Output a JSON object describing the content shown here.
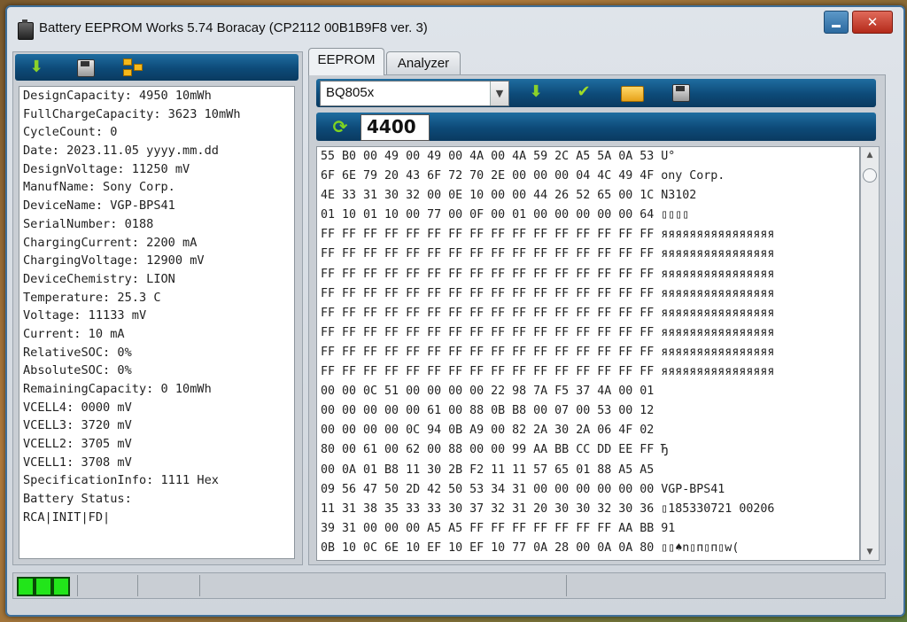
{
  "window": {
    "title": "Battery EEPROM Works  5.74 Boracay (CP2112 00B1B9F8 ver. 3)",
    "close_glyph": "✕"
  },
  "left_panel": {
    "info_lines": [
      "DesignCapacity: 4950 10mWh",
      "FullChargeCapacity: 3623 10mWh",
      "CycleCount: 0",
      "Date: 2023.11.05 yyyy.mm.dd",
      "DesignVoltage: 11250 mV",
      "ManufName: Sony Corp.",
      "DeviceName: VGP-BPS41",
      "SerialNumber: 0188",
      "ChargingCurrent: 2200 mA",
      "ChargingVoltage: 12900 mV",
      "DeviceChemistry: LION",
      "Temperature: 25.3 C",
      "Voltage: 11133 mV",
      "Current: 10 mA",
      "RelativeSOC: 0%",
      "AbsoluteSOC: 0%",
      "RemainingCapacity: 0 10mWh",
      "VCELL4: 0000 mV",
      "VCELL3: 3720 mV",
      "VCELL2: 3705 mV",
      "VCELL1: 3708 mV",
      "SpecificationInfo: 1111 Hex",
      "Battery Status:",
      "RCA|INIT|FD|"
    ]
  },
  "tabs": [
    {
      "label": "EEPROM"
    },
    {
      "label": "Analyzer"
    }
  ],
  "eeprom": {
    "chip_select": "BQ805x",
    "address": "4400",
    "hex_lines": [
      "55 B0 00 49 00 49 00 4A 00 4A 59 2C A5 5A 0A 53 U°",
      "6F 6E 79 20 43 6F 72 70 2E 00 00 00 04 4C 49 4F ony Corp.",
      "4E 33 31 30 32 00 0E 10 00 00 44 26 52 65 00 1C N3102",
      "01 10 01 10 00 77 00 0F 00 01 00 00 00 00 00 64 ▯▯▯▯",
      "FF FF FF FF FF FF FF FF FF FF FF FF FF FF FF FF яяяяяяяяяяяяяяяя",
      "FF FF FF FF FF FF FF FF FF FF FF FF FF FF FF FF яяяяяяяяяяяяяяяя",
      "FF FF FF FF FF FF FF FF FF FF FF FF FF FF FF FF яяяяяяяяяяяяяяяя",
      "FF FF FF FF FF FF FF FF FF FF FF FF FF FF FF FF яяяяяяяяяяяяяяяя",
      "FF FF FF FF FF FF FF FF FF FF FF FF FF FF FF FF яяяяяяяяяяяяяяяя",
      "FF FF FF FF FF FF FF FF FF FF FF FF FF FF FF FF яяяяяяяяяяяяяяяя",
      "FF FF FF FF FF FF FF FF FF FF FF FF FF FF FF FF яяяяяяяяяяяяяяяя",
      "FF FF FF FF FF FF FF FF FF FF FF FF FF FF FF FF яяяяяяяяяяяяяяяя",
      "00 00 0C 51 00 00 00 00 22 98 7A F5 37 4A 00 01",
      "00 00 00 00 00 61 00 88 0B B8 00 07 00 53 00 12",
      "00 00 00 00 0C 94 0B A9 00 82 2A 30 2A 06 4F 02",
      "80 00 61 00 62 00 88 00 00 99 AA BB CC DD EE FF Ђ",
      "00 0A 01 B8 11 30 2B F2 11 11 57 65 01 88 A5 A5",
      "09 56 47 50 2D 42 50 53 34 31 00 00 00 00 00 00 VGP-BPS41",
      "11 31 38 35 33 33 30 37 32 31 20 30 30 32 30 36 ▯185330721 00206",
      "39 31 00 00 00 A5 A5 FF FF FF FF FF FF FF AA BB 91",
      "0B 10 0C 6E 10 EF 10 EF 10 77 0A 28 00 0A 0A 80 ▯▯♠n▯п▯п▯w("
    ]
  },
  "status": {
    "leds": [
      "on",
      "on",
      "on"
    ],
    "led_color": "#22e51a"
  },
  "colors": {
    "toolbar_blue": "#0d4a78",
    "window_border": "#3e6f9a"
  }
}
